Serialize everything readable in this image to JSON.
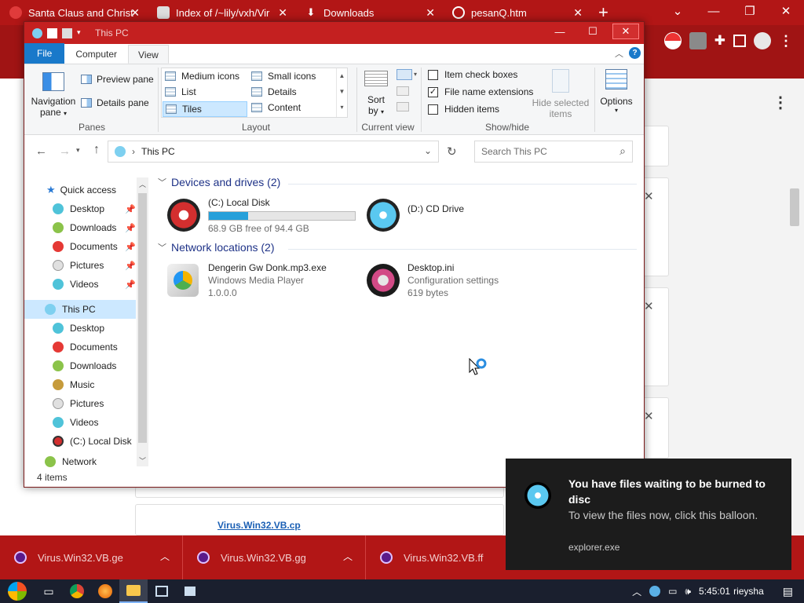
{
  "browser": {
    "tabs": [
      {
        "title": "Santa Claus and Christ",
        "icon": "santa-icon"
      },
      {
        "title": "Index of /~lily/vxh/Vir",
        "icon": "folder-icon"
      },
      {
        "title": "Downloads",
        "icon": "download-icon"
      },
      {
        "title": "pesanQ.htm",
        "icon": "globe-icon"
      }
    ],
    "page_link": "Virus.Win32.VB.cp",
    "downloads": [
      {
        "name": "Virus.Win32.VB.ge"
      },
      {
        "name": "Virus.Win32.VB.gg"
      },
      {
        "name": "Virus.Win32.VB.ff"
      }
    ]
  },
  "explorer": {
    "title": "This PC",
    "ribbon_tabs": [
      "File",
      "Computer",
      "View"
    ],
    "panes": {
      "navigation_pane_line1": "Navigation",
      "navigation_pane_line2": "pane",
      "preview_pane": "Preview pane",
      "details_pane": "Details pane",
      "label": "Panes"
    },
    "layout": {
      "items": [
        "Medium icons",
        "Small icons",
        "List",
        "Details",
        "Tiles",
        "Content"
      ],
      "selected": "Tiles",
      "label": "Layout"
    },
    "current_view": {
      "sort_line1": "Sort",
      "sort_line2": "by",
      "label": "Current view"
    },
    "show_hide": {
      "item_check_boxes": "Item check boxes",
      "file_name_extensions": "File name extensions",
      "hidden_items": "Hidden items",
      "hide_selected_line1": "Hide selected",
      "hide_selected_line2": "items",
      "label": "Show/hide",
      "item_check_boxes_checked": false,
      "file_name_extensions_checked": true,
      "hidden_items_checked": false
    },
    "options": "Options",
    "address": "This PC",
    "search_placeholder": "Search This PC",
    "nav": {
      "quick_access": "Quick access",
      "quick_items": [
        "Desktop",
        "Downloads",
        "Documents",
        "Pictures",
        "Videos"
      ],
      "this_pc": "This PC",
      "pc_items": [
        "Desktop",
        "Documents",
        "Downloads",
        "Music",
        "Pictures",
        "Videos",
        "(C:) Local Disk"
      ],
      "network": "Network"
    },
    "groups": {
      "devices": "Devices and drives (2)",
      "network": "Network locations (2)"
    },
    "drives": [
      {
        "name": "(C:) Local Disk",
        "free": "68.9 GB free of 94.4 GB",
        "used_fraction": 0.27
      },
      {
        "name": "(D:) CD Drive"
      }
    ],
    "network_items": [
      {
        "name": "Dengerin Gw Donk.mp3.exe",
        "line2": "Windows Media Player",
        "line3": "1.0.0.0"
      },
      {
        "name": "Desktop.ini",
        "line2": "Configuration settings",
        "line3": "619 bytes"
      }
    ],
    "status": "4 items"
  },
  "balloon": {
    "title": "You have files waiting to be burned to disc",
    "message": "To view the files now, click this balloon.",
    "source": "explorer.exe"
  },
  "taskbar": {
    "time": "5:45:01",
    "user": "rieysha"
  },
  "colors": {
    "accent": "#1979ca",
    "chrome_theme": "#b21616",
    "title_bar": "#c42020",
    "selection": "#cce8ff",
    "drive_fill": "#26a0da"
  }
}
